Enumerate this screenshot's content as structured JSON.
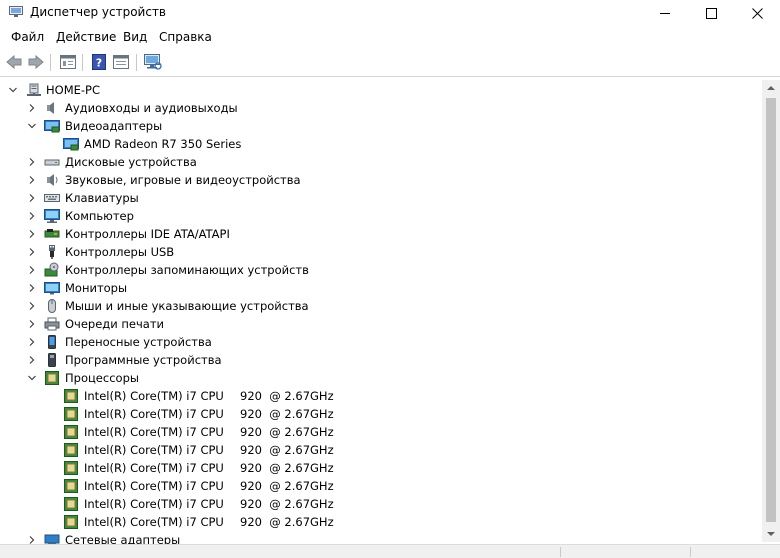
{
  "window": {
    "title": "Диспетчер устройств"
  },
  "menu": {
    "items": [
      "Файл",
      "Действие",
      "Вид",
      "Справка"
    ]
  },
  "tree": {
    "root": "HOME-PC",
    "categories": [
      {
        "label": "Аудиовходы и аудиовыходы",
        "icon": "audio-io-icon"
      },
      {
        "label": "Видеоадаптеры",
        "icon": "display-adapter-icon",
        "expanded": true,
        "children": [
          "AMD Radeon R7 350 Series"
        ]
      },
      {
        "label": "Дисковые устройства",
        "icon": "disk-drive-icon"
      },
      {
        "label": "Звуковые, игровые и видеоустройства",
        "icon": "speaker-icon"
      },
      {
        "label": "Клавиатуры",
        "icon": "keyboard-icon"
      },
      {
        "label": "Компьютер",
        "icon": "computer-icon"
      },
      {
        "label": "Контроллеры IDE ATA/ATAPI",
        "icon": "ide-controller-icon"
      },
      {
        "label": "Контроллеры USB",
        "icon": "usb-icon"
      },
      {
        "label": "Контроллеры запоминающих устройств",
        "icon": "storage-controller-icon"
      },
      {
        "label": "Мониторы",
        "icon": "monitor-icon"
      },
      {
        "label": "Мыши и иные указывающие устройства",
        "icon": "mouse-icon"
      },
      {
        "label": "Очереди печати",
        "icon": "printer-icon"
      },
      {
        "label": "Переносные устройства",
        "icon": "portable-device-icon"
      },
      {
        "label": "Программные устройства",
        "icon": "software-device-icon"
      },
      {
        "label": "Процессоры",
        "icon": "processor-icon",
        "expanded": true
      },
      {
        "label": "Сетевые адаптеры",
        "icon": "network-adapter-icon"
      }
    ],
    "processors": {
      "name": "Intel(R) Core(TM) i7 CPU",
      "speed": "920  @ 2.67GHz",
      "count": 8
    }
  }
}
